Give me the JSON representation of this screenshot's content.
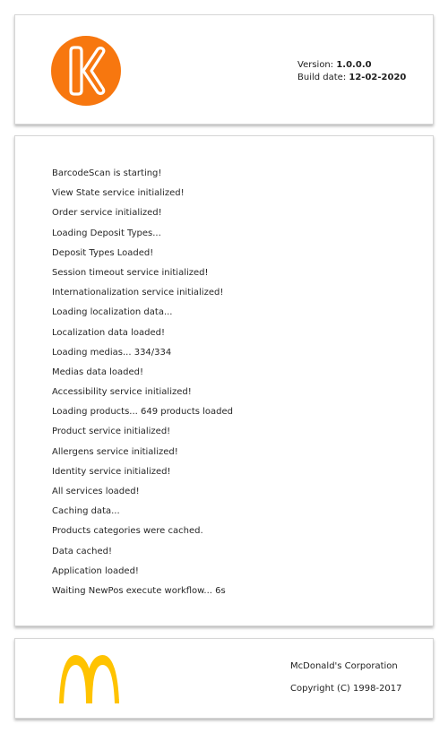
{
  "header": {
    "version_label": "Version:",
    "version_value": "1.0.0.0",
    "build_label": "Build date:",
    "build_value": "12-02-2020",
    "logo_icon": "k-logo-icon",
    "logo_color": "#f7770f"
  },
  "log": {
    "lines": [
      "BarcodeScan is starting!",
      "View State service initialized!",
      "Order service initialized!",
      "Loading Deposit Types...",
      "Deposit Types Loaded!",
      "Session timeout service initialized!",
      "Internationalization service initialized!",
      "Loading localization data...",
      "Localization data loaded!",
      "Loading medias... 334/334",
      "Medias data loaded!",
      "Accessibility service initialized!",
      "Loading products... 649 products loaded",
      "Product service initialized!",
      "Allergens service initialized!",
      "Identity service initialized!",
      "All services loaded!",
      "Caching data...",
      "Products categories were cached.",
      "Data cached!",
      "Application loaded!",
      "Waiting NewPos execute workflow... 6s"
    ]
  },
  "footer": {
    "logo_icon": "mcdonalds-arches-icon",
    "logo_color": "#ffc300",
    "corporation": "McDonald's Corporation",
    "copyright": "Copyright (C) 1998-2017"
  }
}
